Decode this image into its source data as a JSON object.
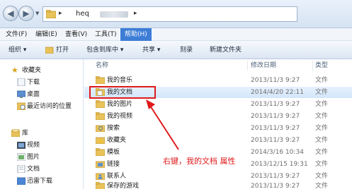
{
  "address_bar": {
    "path_text": "heq",
    "separator": "▸"
  },
  "menu": [
    {
      "label": "文件(F)",
      "active": false
    },
    {
      "label": "编辑(E)",
      "active": false
    },
    {
      "label": "查看(V)",
      "active": false
    },
    {
      "label": "工具(T)",
      "active": false
    },
    {
      "label": "帮助(H)",
      "active": true
    }
  ],
  "toolbar": {
    "organize": "组织 ▾",
    "open": "打开",
    "include_in_library": "包含到库中 ▾",
    "share": "共享 ▾",
    "burn": "刻录",
    "new_folder": "新建文件夹"
  },
  "navpane": {
    "favorites": "收藏夹",
    "favorites_items": [
      "下载",
      "桌面",
      "最近访问的位置"
    ],
    "libraries": "库",
    "library_items": [
      "视频",
      "图片",
      "文档",
      "迅雷下载"
    ]
  },
  "columns": {
    "name": "名称",
    "modified": "修改日期",
    "type": "类型"
  },
  "files": [
    {
      "name": "我的音乐",
      "date": "2013/11/3 9:27",
      "type": "文件"
    },
    {
      "name": "我的文档",
      "date": "2014/4/20 22:11",
      "type": "文件"
    },
    {
      "name": "我的图片",
      "date": "2013/11/3 9:27",
      "type": "文件"
    },
    {
      "name": "我的视频",
      "date": "2013/11/3 9:27",
      "type": "文件"
    },
    {
      "name": "搜索",
      "date": "2013/11/3 9:27",
      "type": "文件"
    },
    {
      "name": "收藏夹",
      "date": "2013/11/3 9:27",
      "type": "文件"
    },
    {
      "name": "模板",
      "date": "2014/3/16 10:34",
      "type": "文件"
    },
    {
      "name": "链接",
      "date": "2013/12/15 19:31",
      "type": "文件"
    },
    {
      "name": "联系人",
      "date": "2013/11/3 9:27",
      "type": "文件"
    },
    {
      "name": "保存的游戏",
      "date": "2013/11/3 9:27",
      "type": "文件"
    }
  ],
  "annotation": "右键，我的文档 属性",
  "colors": {
    "accent": "#3d7dd6",
    "highlight_red": "#e0191b",
    "folder": "#e9c35a"
  }
}
